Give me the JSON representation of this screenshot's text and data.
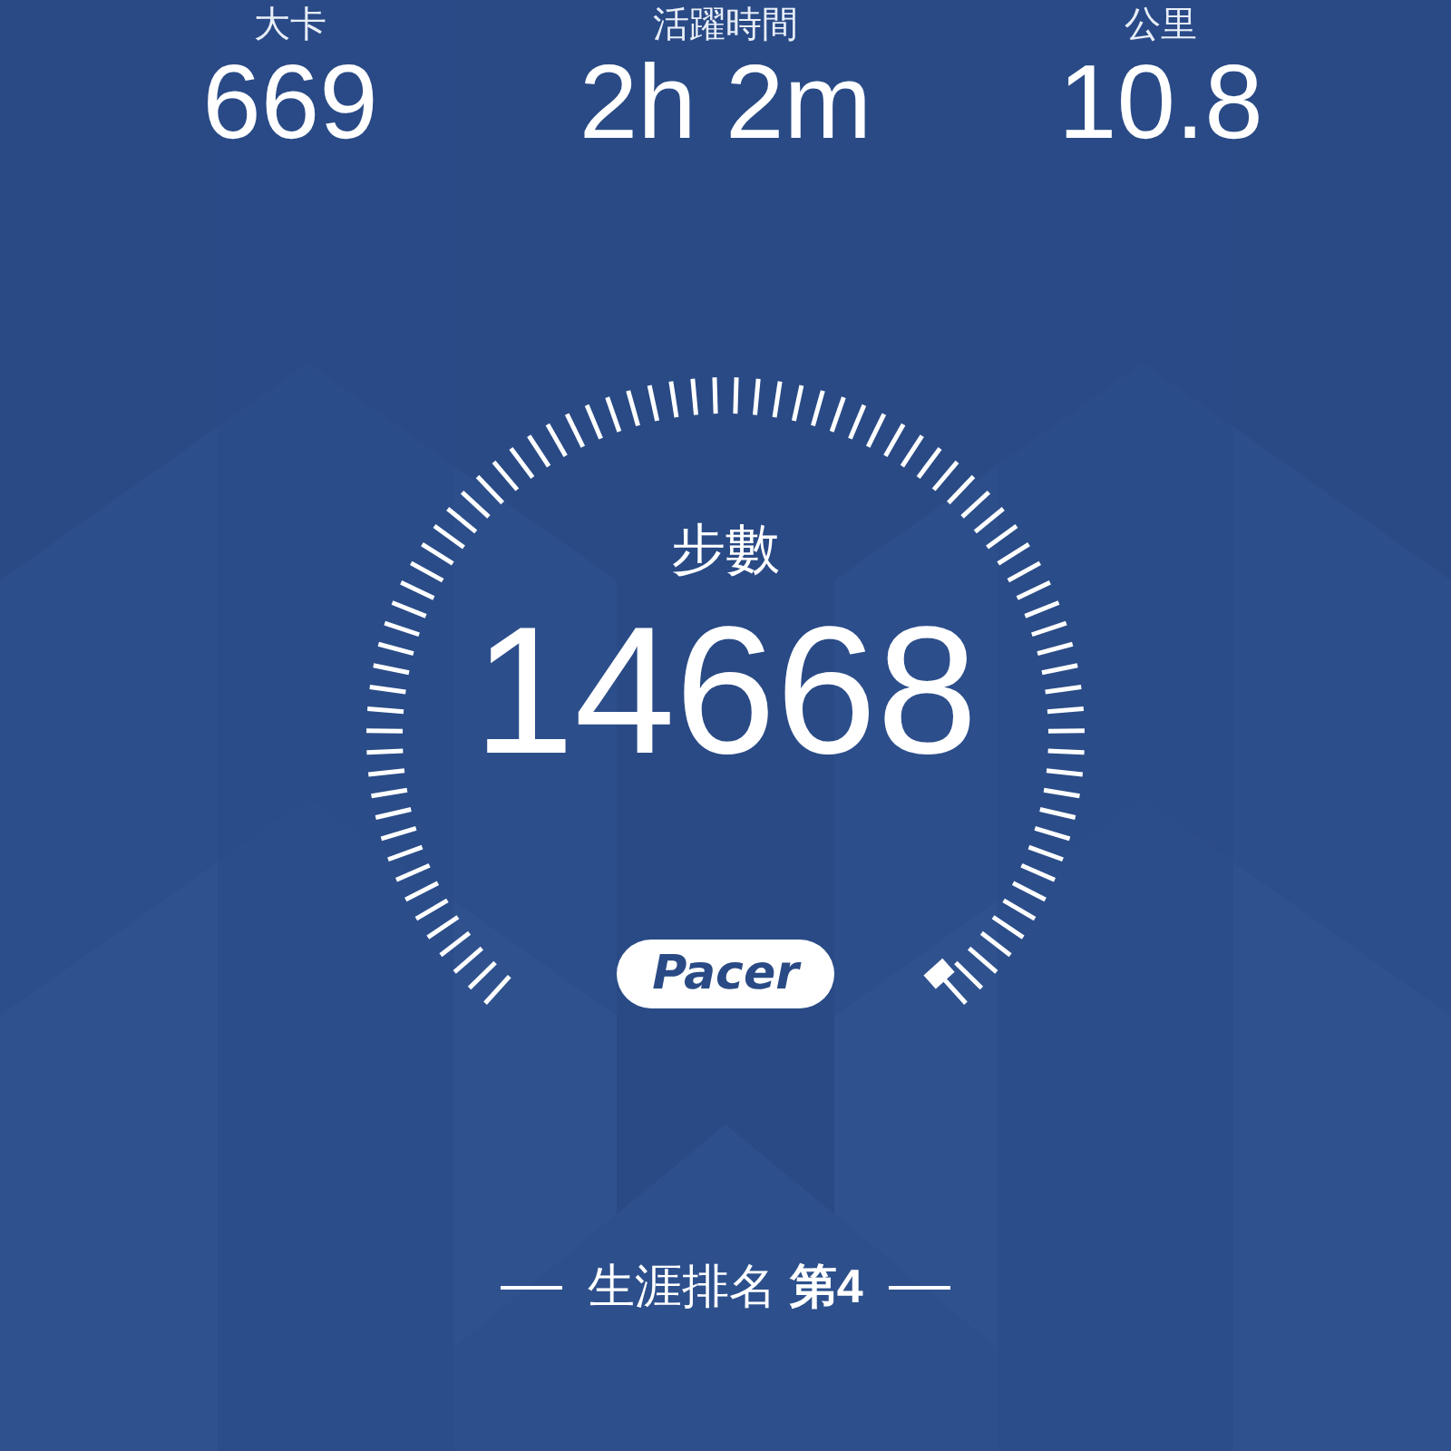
{
  "stats": [
    {
      "label": "大卡",
      "value": "669"
    },
    {
      "label": "活躍時間",
      "value": "2h 2m"
    },
    {
      "label": "公里",
      "value": "10.8"
    }
  ],
  "gauge": {
    "label": "步數",
    "value": "14668"
  },
  "logo": "Pacer",
  "rank": "生涯排名 **第4**"
}
